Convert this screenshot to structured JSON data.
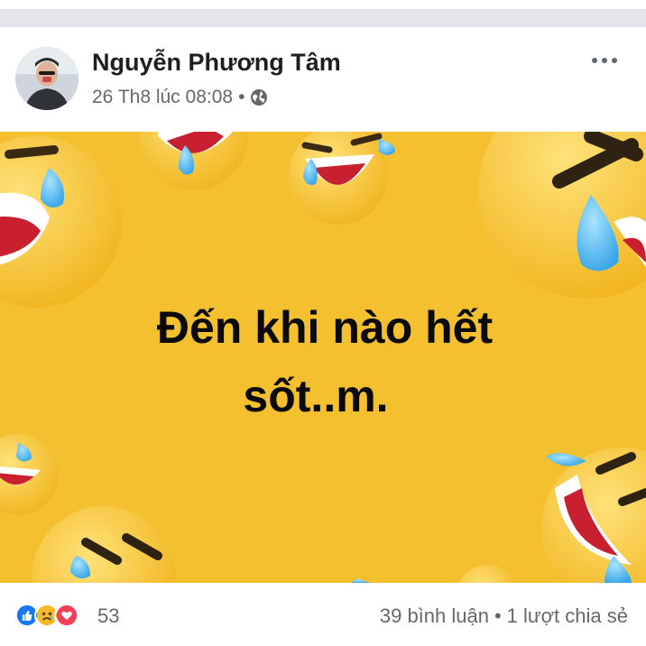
{
  "post": {
    "author": "Nguyễn Phương Tâm",
    "timestamp": "26 Th8 lúc 08:08",
    "separator": "•",
    "privacy_icon": "globe-icon",
    "more_icon": "more-options-icon"
  },
  "image": {
    "background_color": "#F5C02F",
    "caption_line1": "Đến khi nào  hết",
    "caption_line2": "sốt..m."
  },
  "footer": {
    "reaction_icons": [
      "like-icon",
      "sad-icon",
      "love-icon"
    ],
    "reaction_count": "53",
    "comments": "39 bình luận",
    "separator": "•",
    "shares": "1 lượt chia sẻ"
  },
  "colors": {
    "like": "#1877F2",
    "sad": "#F7B928",
    "love": "#F33E58",
    "meta_text": "#65676B"
  }
}
